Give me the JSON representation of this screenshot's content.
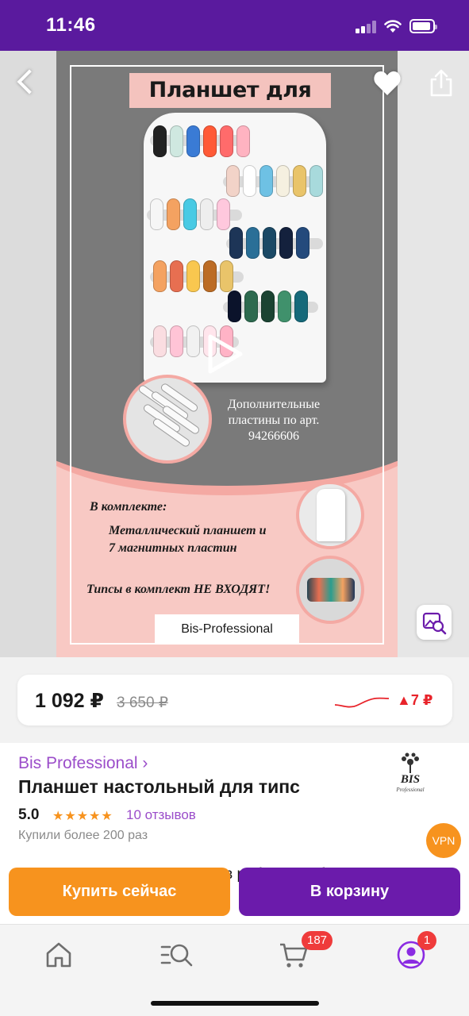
{
  "status_bar": {
    "time": "11:46"
  },
  "gallery": {
    "poster": {
      "title": "Планшет для типс",
      "extra_plates_text": "Дополнительные пластины по арт. 94266606",
      "kit_heading": "В комплекте:",
      "kit_item_1": "Металлический планшет и",
      "kit_item_2": "7 магнитных пластин",
      "tips_note": "Типсы в комплект НЕ ВХОДЯТ!",
      "brand_box": "Bis-Professional"
    },
    "back_icon": "chevron-left-icon",
    "favorite_icon": "heart-icon",
    "share_icon": "share-icon",
    "search_by_photo_icon": "image-search-icon",
    "play_icon": "play-icon"
  },
  "price": {
    "current": "1 092 ₽",
    "old": "3 650 ₽",
    "change": "▲7 ₽",
    "change_color": "#e8232a"
  },
  "product": {
    "brand": "Bis Professional ›",
    "title": "Планшет настольный для типс",
    "rating": "5.0",
    "stars": "★★★★★",
    "reviews": "10 отзывов",
    "bought": "Купили более 200 раз",
    "description": "незаменимым инструментом в работе, чтобы ваш",
    "logo_text": "BIS",
    "logo_subtext": "Professional"
  },
  "vpn_badge": "VPN",
  "actions": {
    "buy_now": "Купить сейчас",
    "add_to_cart": "В корзину"
  },
  "bottom_nav": {
    "items": [
      {
        "icon": "home-icon"
      },
      {
        "icon": "catalog-search-icon"
      },
      {
        "icon": "cart-icon",
        "badge": "187"
      },
      {
        "icon": "profile-icon",
        "badge": "1"
      }
    ]
  },
  "colors": {
    "brand_purple": "#6b1bab",
    "status_bar": "#5a1a9e",
    "accent_orange": "#f7931e",
    "link_purple": "#9b4dca"
  }
}
